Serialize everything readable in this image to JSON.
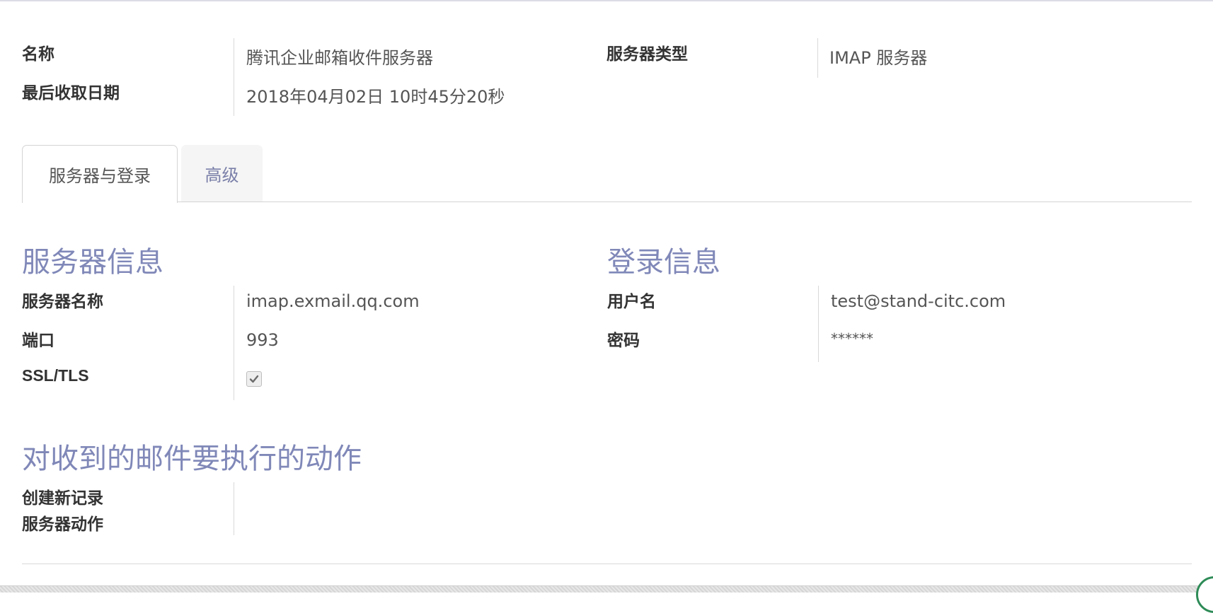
{
  "header": {
    "name_label": "名称",
    "name_value": "腾讯企业邮箱收件服务器",
    "last_fetch_label": "最后收取日期",
    "last_fetch_value": "2018年04月02日 10时45分20秒",
    "server_type_label": "服务器类型",
    "server_type_value": "IMAP 服务器"
  },
  "tabs": [
    {
      "label": "服务器与登录",
      "active": true
    },
    {
      "label": "高级",
      "active": false
    }
  ],
  "server_info": {
    "title": "服务器信息",
    "server_name_label": "服务器名称",
    "server_name_value": "imap.exmail.qq.com",
    "port_label": "端口",
    "port_value": "993",
    "ssl_label": "SSL/TLS",
    "ssl_checked": true
  },
  "login_info": {
    "title": "登录信息",
    "username_label": "用户名",
    "username_value": "test@stand-citc.com",
    "password_label": "密码",
    "password_value": "******"
  },
  "actions": {
    "title": "对收到的邮件要执行的动作",
    "create_record_label": "创建新记录",
    "server_action_label": "服务器动作"
  },
  "colors": {
    "section_title": "#8088b8",
    "inactive_tab_text": "#7a7fa8"
  },
  "icons": {
    "checkbox": "check-icon"
  }
}
